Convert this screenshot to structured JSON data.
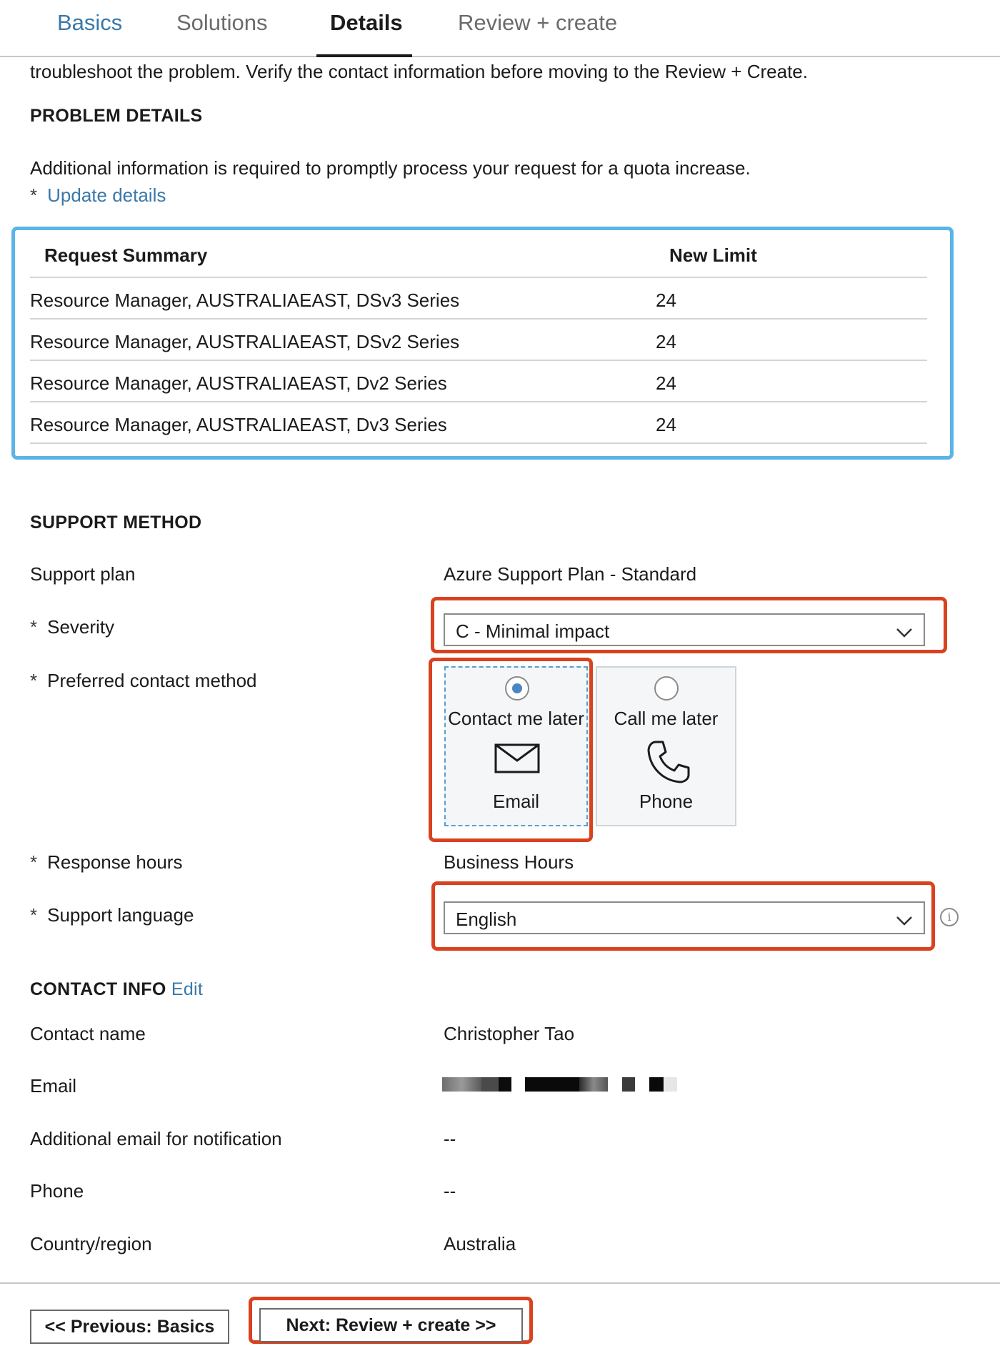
{
  "tabs": [
    {
      "label": "Basics"
    },
    {
      "label": "Solutions"
    },
    {
      "label": "Details"
    },
    {
      "label": "Review + create"
    }
  ],
  "intro_text": "troubleshoot the problem. Verify the contact information before moving to the Review + Create.",
  "problem_details": {
    "heading": "PROBLEM DETAILS",
    "description": "Additional information is required to promptly process your request for a quota increase.",
    "required_marker": "*",
    "update_link": "Update details"
  },
  "summary_table": {
    "columns": [
      "Request Summary",
      "New Limit"
    ],
    "rows": [
      {
        "summary": "Resource Manager, AUSTRALIAEAST, DSv3 Series",
        "limit": "24"
      },
      {
        "summary": "Resource Manager, AUSTRALIAEAST, DSv2 Series",
        "limit": "24"
      },
      {
        "summary": "Resource Manager, AUSTRALIAEAST, Dv2 Series",
        "limit": "24"
      },
      {
        "summary": "Resource Manager, AUSTRALIAEAST, Dv3 Series",
        "limit": "24"
      }
    ]
  },
  "support_method": {
    "heading": "SUPPORT METHOD",
    "support_plan_label": "Support plan",
    "support_plan_value": "Azure Support Plan - Standard",
    "severity_label": "Severity",
    "severity_value": "C - Minimal impact",
    "contact_method_label": "Preferred contact method",
    "contact_options": [
      {
        "title": "Contact me later",
        "subtitle": "Email",
        "icon": "envelope-icon",
        "selected": true
      },
      {
        "title": "Call me later",
        "subtitle": "Phone",
        "icon": "phone-icon",
        "selected": false
      }
    ],
    "response_hours_label": "Response hours",
    "response_hours_value": "Business Hours",
    "language_label": "Support language",
    "language_value": "English"
  },
  "contact_info": {
    "heading": "CONTACT INFO",
    "edit_link": "Edit",
    "fields": [
      {
        "label": "Contact name",
        "value": "Christopher Tao"
      },
      {
        "label": "Email",
        "value": ""
      },
      {
        "label": "Additional email for notification",
        "value": "--"
      },
      {
        "label": "Phone",
        "value": "--"
      },
      {
        "label": "Country/region",
        "value": "Australia"
      }
    ]
  },
  "buttons": {
    "previous": "<< Previous: Basics",
    "next": "Next: Review + create >>"
  },
  "colors": {
    "link": "#3a78a8",
    "summary_highlight": "#5ab4e8",
    "annotation_red": "#d9421e",
    "radio_selected": "#4a86c0"
  }
}
